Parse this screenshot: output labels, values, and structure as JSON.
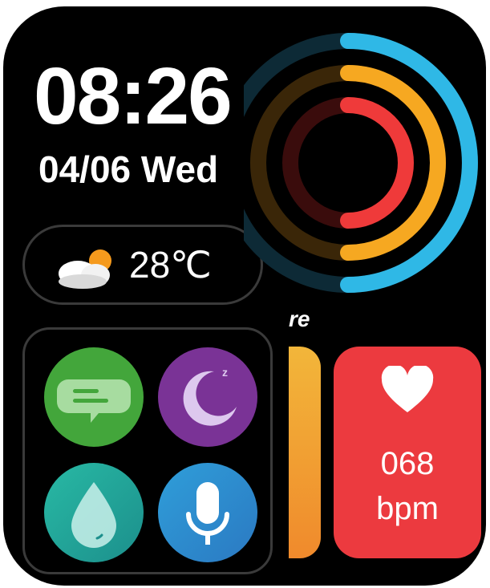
{
  "clock": {
    "time": "08:26",
    "date": "04/06 Wed"
  },
  "weather": {
    "icon": "partly-cloudy-icon",
    "temperature": "28℃"
  },
  "activity": {
    "partial_label": "re",
    "rings": [
      {
        "name": "outer",
        "color": "#2fb8e6",
        "progress": 0.5
      },
      {
        "name": "middle",
        "color": "#f6a821",
        "progress": 0.5
      },
      {
        "name": "inner",
        "color": "#ef3a3a",
        "progress": 0.5
      }
    ]
  },
  "apps": [
    {
      "name": "messages",
      "icon": "message-icon",
      "color": "#43a63b"
    },
    {
      "name": "sleep",
      "icon": "moon-icon",
      "color": "#7a3396"
    },
    {
      "name": "water",
      "icon": "water-drop-icon",
      "color": "#28b9a4"
    },
    {
      "name": "voice",
      "icon": "microphone-icon",
      "color": "#2f9ed9"
    }
  ],
  "heart_rate": {
    "icon": "heart-icon",
    "value": "068",
    "unit": "bpm",
    "color": "#ec3a3f"
  },
  "colors": {
    "background": "#000000",
    "border": "#3a3a3a"
  }
}
